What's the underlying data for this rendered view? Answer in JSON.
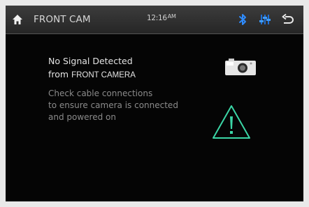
{
  "header": {
    "title": "FRONT CAM",
    "time": "12:16",
    "ampm": "AM"
  },
  "message": {
    "title": "No Signal Detected",
    "from_prefix": "from",
    "source": "FRONT CAMERA",
    "hint_lines": [
      "Check cable connections",
      "to ensure camera is connected",
      "and powered on"
    ]
  },
  "icons": {
    "home": "home-icon",
    "bluetooth": "bluetooth-icon",
    "equalizer": "equalizer-icon",
    "back": "back-icon",
    "camera": "camera-icon",
    "warning": "warning-icon"
  },
  "colors": {
    "accent_blue": "#2f8cff",
    "warning_green": "#3bd6a6",
    "background": "#050505"
  }
}
